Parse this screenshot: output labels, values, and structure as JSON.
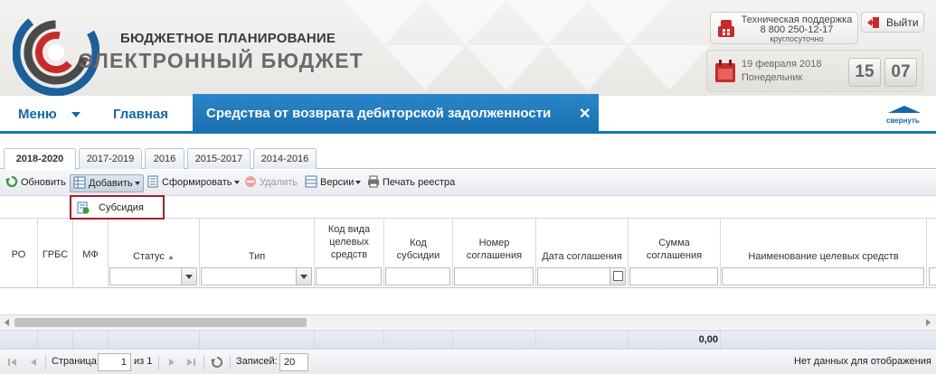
{
  "header": {
    "brand_line1": "БЮДЖЕТНОЕ ПЛАНИРОВАНИЕ",
    "brand_line2": "ЭЛЕКТРОННЫЙ БЮДЖЕТ",
    "support": {
      "title": "Техническая поддержка",
      "phone": "8 800 250-12-17",
      "hours": "круглосуточно",
      "icon": "support-phone-icon"
    },
    "exit_label": "Выйти",
    "date": "19 февраля 2018",
    "weekday": "Понедельник",
    "clock_hours": "15",
    "clock_minutes": "07"
  },
  "nav": {
    "menu_label": "Меню",
    "home_label": "Главная",
    "active_tab": "Средства от возврата дебиторской задолженности",
    "close_symbol": "✕",
    "collapse_label": "свернуть"
  },
  "year_tabs": [
    "2018-2020",
    "2017-2019",
    "2016",
    "2015-2017",
    "2014-2016"
  ],
  "active_year_tab": "2018-2020",
  "toolbar": {
    "refresh": "Обновить",
    "add": "Добавить",
    "form": "Сформировать",
    "delete": "Удалить",
    "versions": "Версии",
    "print": "Печать реестра"
  },
  "add_menu": {
    "items": [
      "Субсидия"
    ]
  },
  "grid": {
    "columns": {
      "ro": "РО",
      "grbs": "ГРБС",
      "mf": "МФ",
      "status": "Статус",
      "type": "Тип",
      "target_code_1": "Код вида",
      "target_code_2": "целевых",
      "target_code_3": "средств",
      "subsidy_code_1": "Код",
      "subsidy_code_2": "субсидии",
      "agreement_no_1": "Номер",
      "agreement_no_2": "соглашения",
      "agreement_date": "Дата соглашения",
      "agreement_sum_1": "Сумма",
      "agreement_sum_2": "соглашения",
      "target_name": "Наименование целевых средств"
    },
    "total": "0,00"
  },
  "pager": {
    "page_label": "Страница",
    "page_value": "1",
    "of_label": "из 1",
    "records_label": "Записей:",
    "records_value": "20",
    "status": "Нет данных для отображения"
  },
  "colors": {
    "accent_blue": "#1a6fb0",
    "highlight_red": "#a11f2e"
  }
}
